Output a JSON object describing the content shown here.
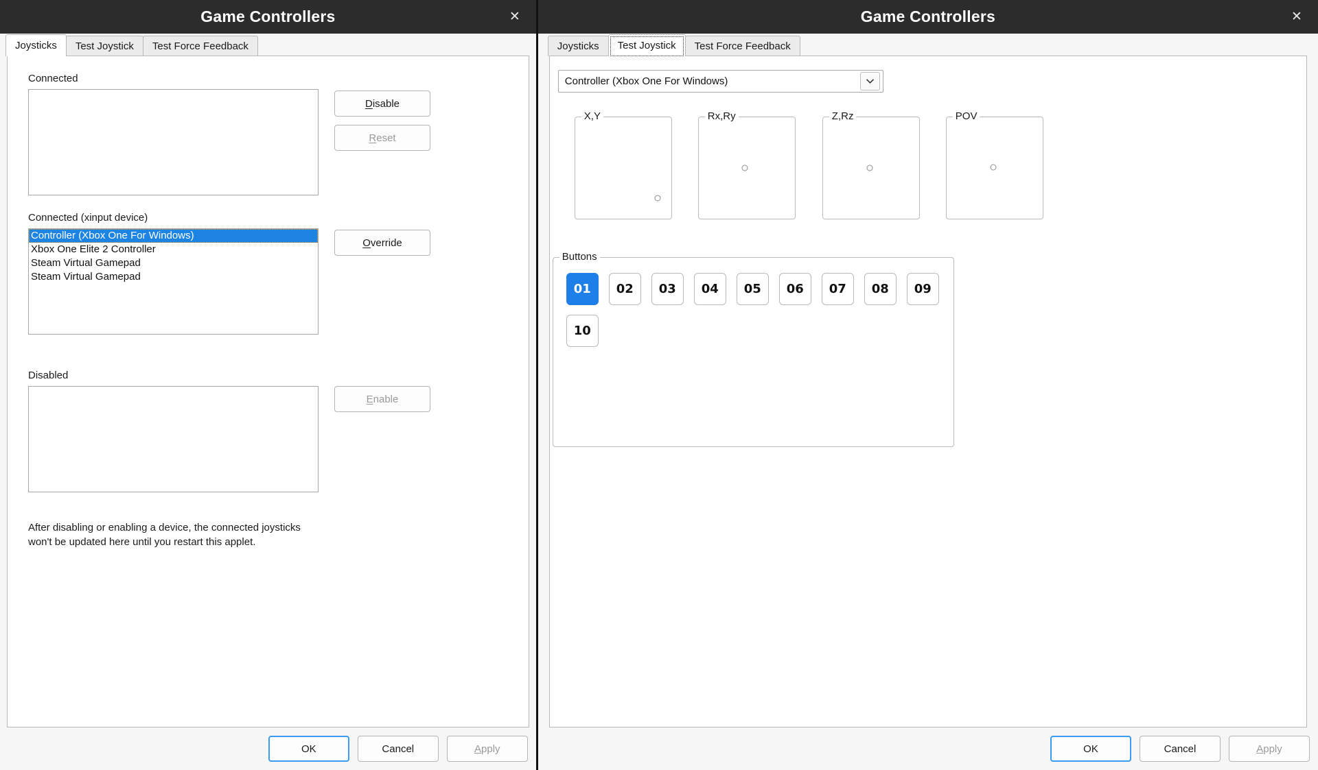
{
  "colors": {
    "accent": "#1e7fe8",
    "selection": "#1e84e4",
    "titlebar": "#2c2c2c",
    "focus_border": "#3a9bf0"
  },
  "left_window": {
    "title": "Game Controllers",
    "close_icon": "close-icon",
    "tabs": [
      {
        "label": "Joysticks",
        "active": true
      },
      {
        "label": "Test Joystick",
        "active": false
      },
      {
        "label": "Test Force Feedback",
        "active": false
      }
    ],
    "connected": {
      "label": "Connected",
      "items": [],
      "buttons": [
        {
          "label": "Disable",
          "mnemonic": "D",
          "disabled": false
        },
        {
          "label": "Reset",
          "mnemonic": "R",
          "disabled": true
        }
      ]
    },
    "connected_xinput": {
      "label": "Connected (xinput device)",
      "items": [
        {
          "label": "Controller (Xbox One For Windows)",
          "selected": true
        },
        {
          "label": "Xbox One Elite 2 Controller",
          "selected": false
        },
        {
          "label": "Steam Virtual Gamepad",
          "selected": false
        },
        {
          "label": "Steam Virtual Gamepad",
          "selected": false
        }
      ],
      "buttons": [
        {
          "label": "Override",
          "mnemonic": "O",
          "disabled": false
        }
      ]
    },
    "disabled_section": {
      "label": "Disabled",
      "items": [],
      "buttons": [
        {
          "label": "Enable",
          "mnemonic": "E",
          "disabled": true
        }
      ]
    },
    "note": "After disabling or enabling a device, the connected joysticks won't be updated here until you restart this applet.",
    "footer": [
      {
        "label": "OK",
        "default": true,
        "disabled": false
      },
      {
        "label": "Cancel",
        "default": false,
        "disabled": false
      },
      {
        "label": "Apply",
        "mnemonic": "A",
        "default": false,
        "disabled": true
      }
    ]
  },
  "right_window": {
    "title": "Game Controllers",
    "close_icon": "close-icon",
    "tabs": [
      {
        "label": "Joysticks",
        "active": false
      },
      {
        "label": "Test Joystick",
        "active": true
      },
      {
        "label": "Test Force Feedback",
        "active": false
      }
    ],
    "device_combo": {
      "value": "Controller (Xbox One For Windows)",
      "arrow_icon": "chevron-down-icon"
    },
    "axes": [
      {
        "label": "X,Y",
        "dot_x_pct": 86,
        "dot_y_pct": 80
      },
      {
        "label": "Rx,Ry",
        "dot_x_pct": 48,
        "dot_y_pct": 50
      },
      {
        "label": "Z,Rz",
        "dot_x_pct": 49,
        "dot_y_pct": 50
      },
      {
        "label": "POV",
        "dot_x_pct": 49,
        "dot_y_pct": 49
      }
    ],
    "buttons_group": {
      "label": "Buttons",
      "buttons": [
        {
          "label": "01",
          "pressed": true
        },
        {
          "label": "02",
          "pressed": false
        },
        {
          "label": "03",
          "pressed": false
        },
        {
          "label": "04",
          "pressed": false
        },
        {
          "label": "05",
          "pressed": false
        },
        {
          "label": "06",
          "pressed": false
        },
        {
          "label": "07",
          "pressed": false
        },
        {
          "label": "08",
          "pressed": false
        },
        {
          "label": "09",
          "pressed": false
        },
        {
          "label": "10",
          "pressed": false
        }
      ]
    },
    "footer": [
      {
        "label": "OK",
        "default": true,
        "disabled": false
      },
      {
        "label": "Cancel",
        "default": false,
        "disabled": false
      },
      {
        "label": "Apply",
        "mnemonic": "A",
        "default": false,
        "disabled": true
      }
    ]
  }
}
